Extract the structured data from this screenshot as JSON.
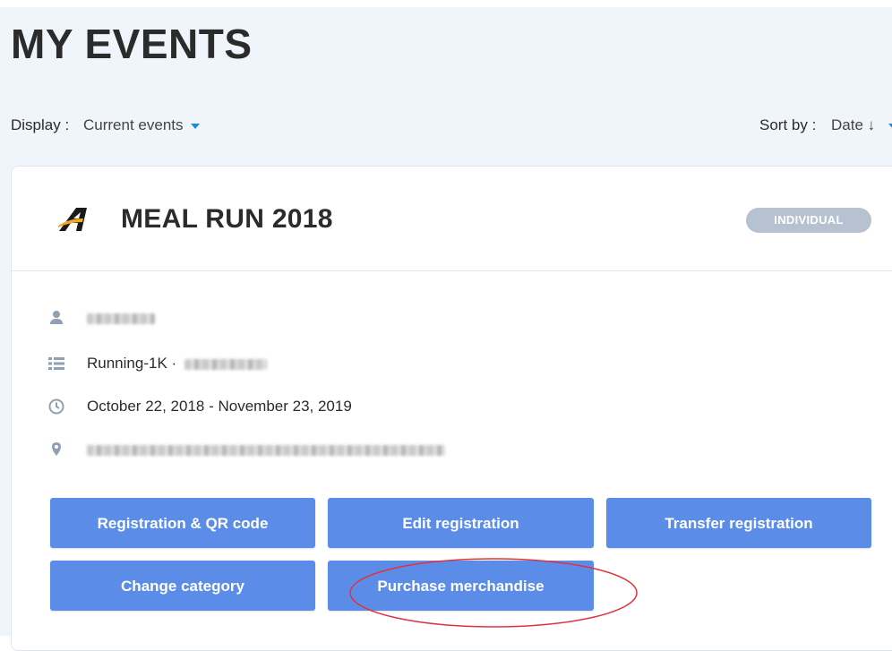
{
  "page": {
    "title": "MY EVENTS"
  },
  "filters": {
    "display_label": "Display :",
    "display_value": "Current events",
    "sort_label": "Sort by :",
    "sort_value": "Date ↓"
  },
  "event": {
    "title": "MEAL RUN 2018",
    "badge": "INDIVIDUAL",
    "logo": "brand-a-logo",
    "details": {
      "participant_icon": "user-icon",
      "category_icon": "list-icon",
      "category_prefix": "Running-1K ·",
      "dates_icon": "clock-icon",
      "dates": "October 22, 2018 - November 23, 2019",
      "location_icon": "location-pin-icon"
    },
    "actions": {
      "registration_qr": "Registration & QR code",
      "edit_registration": "Edit registration",
      "transfer_registration": "Transfer registration",
      "change_category": "Change category",
      "purchase_merchandise": "Purchase merchandise"
    }
  },
  "colors": {
    "accent_caret": "#1e8ad6",
    "button": "#5b8de8",
    "badge": "#b6c2cf",
    "annotation": "#e0323c",
    "background": "#eff5fb"
  }
}
